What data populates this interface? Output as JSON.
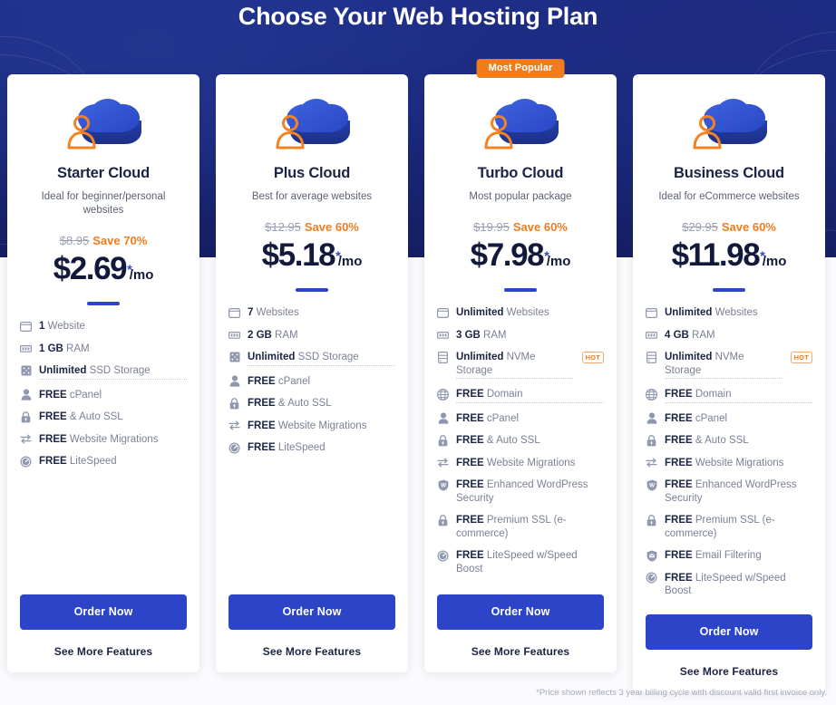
{
  "header": {
    "title": "Choose Your Web Hosting Plan"
  },
  "colors": {
    "hero_bg": "#1b2a7e",
    "accent_blue": "#2c44c8",
    "accent_orange": "#f07c1e",
    "heading_dark": "#1b2445",
    "body_gray": "#7b8196"
  },
  "badge": {
    "most_popular": "Most Popular"
  },
  "buttons": {
    "order_now": "Order Now",
    "see_more_features": "See More Features"
  },
  "footnote": "*Price shown reflects 3 year billing cycle with discount valid first invoice only.",
  "plans": [
    {
      "id": "starter-cloud",
      "name": "Starter Cloud",
      "tagline": "Ideal for beginner/personal websites",
      "old_price": "$8.95",
      "save": "Save 70%",
      "price": "$2.69",
      "star": "*",
      "per": "/mo",
      "featured": false,
      "badge": "",
      "order_now": "Order Now",
      "see_more_features": "See More Features",
      "features": [
        {
          "icon": "browser-window-icon",
          "strong": "1",
          "rest": " Website",
          "dotted": false,
          "hot": ""
        },
        {
          "icon": "ram-icon",
          "strong": "1 GB",
          "rest": " RAM",
          "dotted": false,
          "hot": ""
        },
        {
          "icon": "ssd-storage-icon",
          "strong": "Unlimited",
          "rest": " SSD Storage",
          "dotted": true,
          "hot": ""
        },
        {
          "icon": "user-icon",
          "strong": "FREE",
          "rest": " cPanel",
          "dotted": false,
          "hot": ""
        },
        {
          "icon": "lock-icon",
          "strong": "FREE",
          "rest": " & Auto SSL",
          "dotted": false,
          "hot": ""
        },
        {
          "icon": "migration-arrows-icon",
          "strong": "FREE",
          "rest": " Website Migrations",
          "dotted": false,
          "hot": ""
        },
        {
          "icon": "speed-gauge-icon",
          "strong": "FREE",
          "rest": " LiteSpeed",
          "dotted": false,
          "hot": ""
        }
      ]
    },
    {
      "id": "plus-cloud",
      "name": "Plus Cloud",
      "tagline": "Best for average websites",
      "old_price": "$12.95",
      "save": "Save 60%",
      "price": "$5.18",
      "star": "*",
      "per": "/mo",
      "featured": false,
      "badge": "",
      "order_now": "Order Now",
      "see_more_features": "See More Features",
      "features": [
        {
          "icon": "browser-window-icon",
          "strong": "7",
          "rest": " Websites",
          "dotted": false,
          "hot": ""
        },
        {
          "icon": "ram-icon",
          "strong": "2 GB",
          "rest": " RAM",
          "dotted": false,
          "hot": ""
        },
        {
          "icon": "ssd-storage-icon",
          "strong": "Unlimited",
          "rest": " SSD Storage",
          "dotted": true,
          "hot": ""
        },
        {
          "icon": "user-icon",
          "strong": "FREE",
          "rest": " cPanel",
          "dotted": false,
          "hot": ""
        },
        {
          "icon": "lock-icon",
          "strong": "FREE",
          "rest": " & Auto SSL",
          "dotted": false,
          "hot": ""
        },
        {
          "icon": "migration-arrows-icon",
          "strong": "FREE",
          "rest": " Website Migrations",
          "dotted": false,
          "hot": ""
        },
        {
          "icon": "speed-gauge-icon",
          "strong": "FREE",
          "rest": " LiteSpeed",
          "dotted": false,
          "hot": ""
        }
      ]
    },
    {
      "id": "turbo-cloud",
      "name": "Turbo Cloud",
      "tagline": "Most popular package",
      "old_price": "$19.95",
      "save": "Save 60%",
      "price": "$7.98",
      "star": "*",
      "per": "/mo",
      "featured": true,
      "badge": "Most Popular",
      "order_now": "Order Now",
      "see_more_features": "See More Features",
      "features": [
        {
          "icon": "browser-window-icon",
          "strong": "Unlimited",
          "rest": " Websites",
          "dotted": false,
          "hot": ""
        },
        {
          "icon": "ram-icon",
          "strong": "3 GB",
          "rest": " RAM",
          "dotted": false,
          "hot": ""
        },
        {
          "icon": "nvme-storage-icon",
          "strong": "Unlimited",
          "rest": " NVMe Storage",
          "dotted": true,
          "hot": "HOT"
        },
        {
          "icon": "globe-icon",
          "strong": "FREE",
          "rest": " Domain",
          "dotted": true,
          "hot": ""
        },
        {
          "icon": "user-icon",
          "strong": "FREE",
          "rest": " cPanel",
          "dotted": false,
          "hot": ""
        },
        {
          "icon": "lock-icon",
          "strong": "FREE",
          "rest": " & Auto SSL",
          "dotted": false,
          "hot": ""
        },
        {
          "icon": "migration-arrows-icon",
          "strong": "FREE",
          "rest": " Website Migrations",
          "dotted": false,
          "hot": ""
        },
        {
          "icon": "wordpress-shield-icon",
          "strong": "FREE",
          "rest": " Enhanced WordPress Security",
          "dotted": false,
          "hot": ""
        },
        {
          "icon": "lock-icon",
          "strong": "FREE",
          "rest": " Premium SSL (e-commerce)",
          "dotted": false,
          "hot": ""
        },
        {
          "icon": "speed-gauge-icon",
          "strong": "FREE",
          "rest": " LiteSpeed w/Speed Boost",
          "dotted": false,
          "hot": ""
        }
      ]
    },
    {
      "id": "business-cloud",
      "name": "Business Cloud",
      "tagline": "Ideal for eCommerce websites",
      "old_price": "$29.95",
      "save": "Save 60%",
      "price": "$11.98",
      "star": "*",
      "per": "/mo",
      "featured": false,
      "badge": "",
      "order_now": "Order Now",
      "see_more_features": "See More Features",
      "features": [
        {
          "icon": "browser-window-icon",
          "strong": "Unlimited",
          "rest": " Websites",
          "dotted": false,
          "hot": ""
        },
        {
          "icon": "ram-icon",
          "strong": "4 GB",
          "rest": " RAM",
          "dotted": false,
          "hot": ""
        },
        {
          "icon": "nvme-storage-icon",
          "strong": "Unlimited",
          "rest": " NVMe Storage",
          "dotted": true,
          "hot": "HOT"
        },
        {
          "icon": "globe-icon",
          "strong": "FREE",
          "rest": " Domain",
          "dotted": true,
          "hot": ""
        },
        {
          "icon": "user-icon",
          "strong": "FREE",
          "rest": " cPanel",
          "dotted": false,
          "hot": ""
        },
        {
          "icon": "lock-icon",
          "strong": "FREE",
          "rest": " & Auto SSL",
          "dotted": false,
          "hot": ""
        },
        {
          "icon": "migration-arrows-icon",
          "strong": "FREE",
          "rest": " Website Migrations",
          "dotted": false,
          "hot": ""
        },
        {
          "icon": "wordpress-shield-icon",
          "strong": "FREE",
          "rest": " Enhanced WordPress Security",
          "dotted": false,
          "hot": ""
        },
        {
          "icon": "lock-icon",
          "strong": "FREE",
          "rest": " Premium SSL (e-commerce)",
          "dotted": false,
          "hot": ""
        },
        {
          "icon": "email-filter-icon",
          "strong": "FREE",
          "rest": " Email Filtering",
          "dotted": false,
          "hot": ""
        },
        {
          "icon": "speed-gauge-icon",
          "strong": "FREE",
          "rest": " LiteSpeed w/Speed Boost",
          "dotted": false,
          "hot": ""
        }
      ]
    }
  ]
}
